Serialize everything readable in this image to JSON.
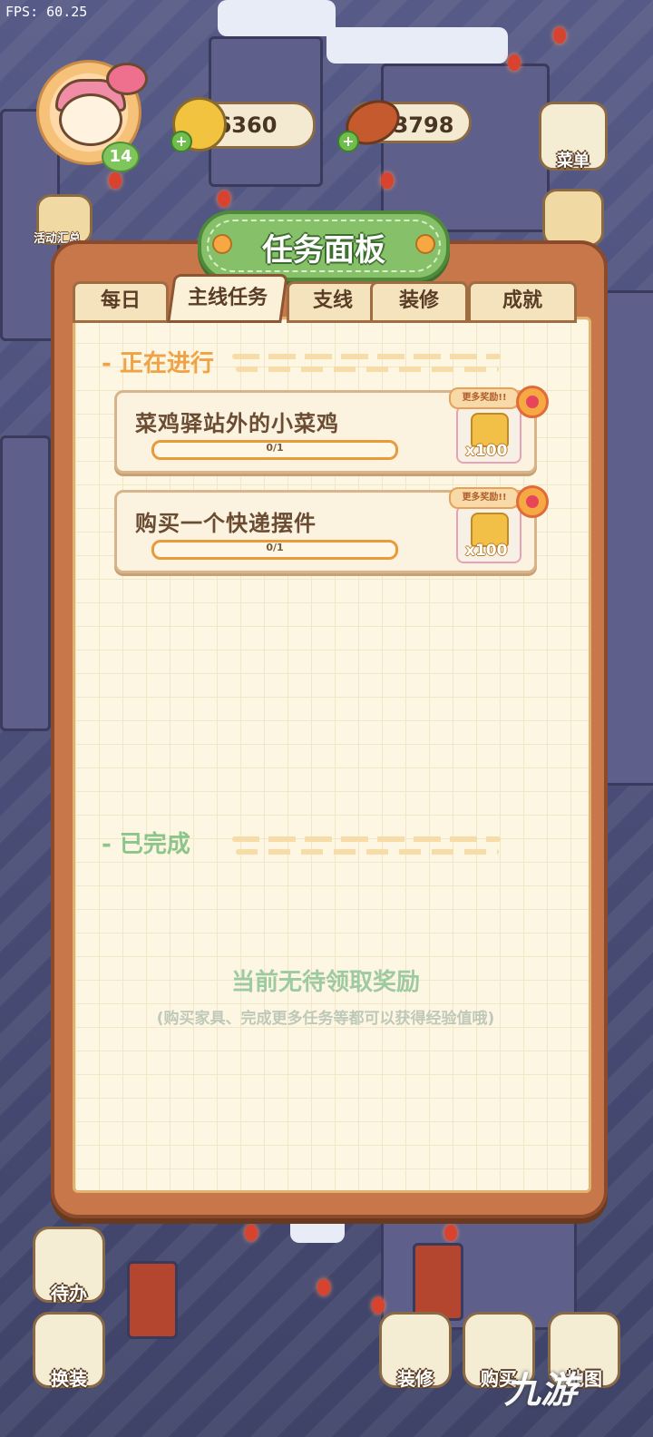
{
  "fps": "FPS: 60.25",
  "player": {
    "level": "14"
  },
  "currency": {
    "coins": "6360",
    "food": "3798"
  },
  "side_buttons": {
    "menu": "菜单",
    "events_small": "活动汇总"
  },
  "panel": {
    "title": "任务面板",
    "tabs": [
      "每日",
      "主线任务",
      "支线",
      "装修",
      "成就"
    ],
    "active_tab": "主线任务",
    "in_progress_title": "正在进行",
    "completed_title": "已完成",
    "tasks": [
      {
        "name": "菜鸡驿站外的小菜鸡",
        "progress": "0/1",
        "progress_value": 0,
        "reward_tag": "更多奖励!!",
        "reward_count": "x100"
      },
      {
        "name": "购买一个快递摆件",
        "progress": "0/1",
        "progress_value": 0,
        "reward_tag": "更多奖励!!",
        "reward_count": "x100"
      }
    ],
    "empty_main": "当前无待领取奖励",
    "empty_sub": "(购买家具、完成更多任务等都可以获得经验值哦)"
  },
  "bottom": {
    "todo": "待办",
    "dressup": "换装",
    "decorate": "装修",
    "buy": "购买",
    "map": "地图"
  },
  "watermark": "九游",
  "colors": {
    "panel": "#c8774a",
    "paper": "#fdf6e2",
    "title_plate": "#86c16a",
    "progress_orange": "#f4a64a",
    "section_orange": "#f0a346",
    "section_green": "#8cc58a"
  }
}
